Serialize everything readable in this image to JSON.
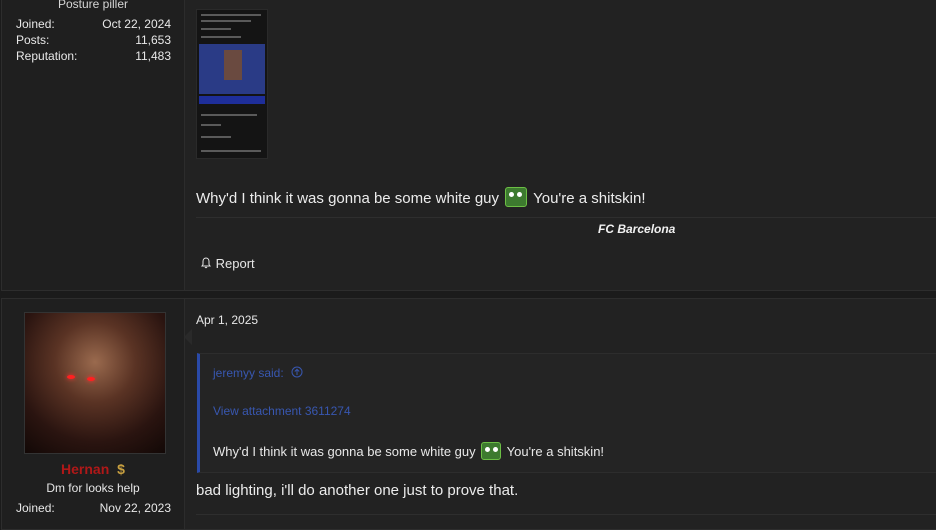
{
  "post1": {
    "user_title": "Posture piller",
    "stats": [
      {
        "label": "Joined:",
        "value": "Oct 22, 2024"
      },
      {
        "label": "Posts:",
        "value": "11,653"
      },
      {
        "label": "Reputation:",
        "value": "11,483"
      }
    ],
    "message_before": "Why'd I think it was gonna be some white guy",
    "message_after": "You're a shitskin!",
    "signature": "FC Barcelona",
    "report_label": "Report",
    "emoji_icon": "pepe-laugh-icon"
  },
  "post2": {
    "username": "Hernan",
    "username_badge": "$",
    "user_title": "Dm for looks help",
    "stats": [
      {
        "label": "Joined:",
        "value": "Nov 22, 2023"
      }
    ],
    "date": "Apr 1, 2025",
    "quote": {
      "author": "jeremyy said:",
      "attachment": "View attachment 3611274",
      "text_before": "Why'd I think it was gonna be some white guy",
      "text_after": "You're a shitskin!"
    },
    "reply": "bad lighting, i'll do another one just to prove that."
  },
  "colors": {
    "background": "#1b1b1b",
    "post_bg": "#222222",
    "quote_border": "#2a4aa8",
    "link": "#3857b0",
    "username": "#b01818"
  }
}
